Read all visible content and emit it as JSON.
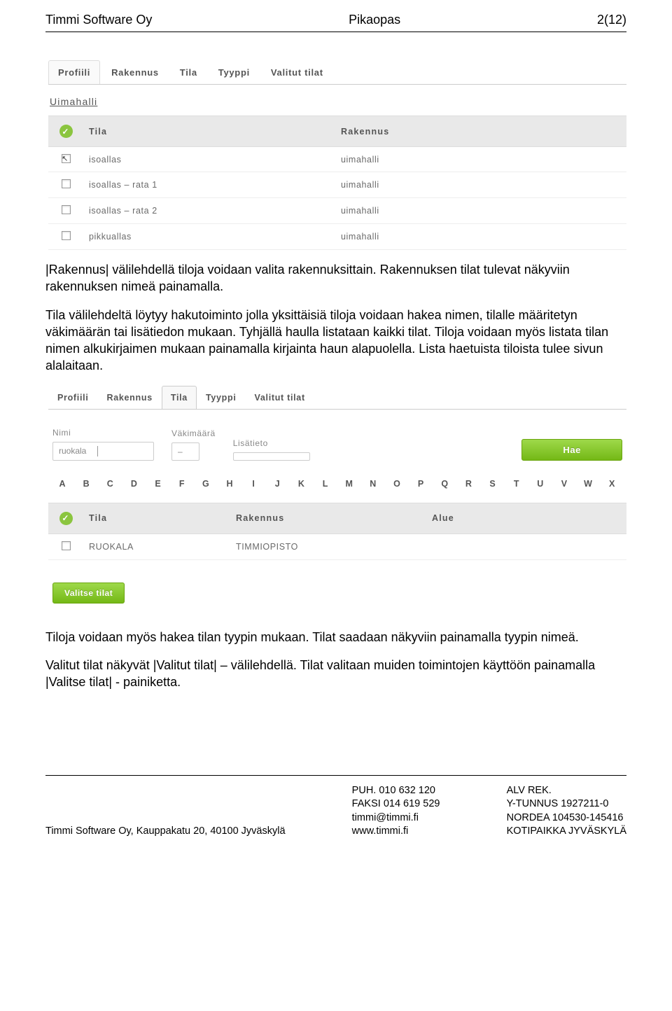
{
  "header": {
    "company": "Timmi Software Oy",
    "title": "Pikaopas",
    "page": "2(12)"
  },
  "paragraphs": {
    "p1": "|Rakennus| välilehdellä tiloja voidaan valita rakennuksittain. Rakennuksen tilat tulevat näkyviin rakennuksen nimeä painamalla.",
    "p2": "Tila välilehdeltä löytyy hakutoiminto jolla yksittäisiä tiloja voidaan hakea nimen, tilalle määritetyn väkimäärän tai lisätiedon mukaan. Tyhjällä haulla listataan kaikki tilat. Tiloja voidaan myös listata tilan nimen alkukirjaimen mukaan painamalla kirjainta haun alapuolella. Lista haetuista tiloista tulee sivun alalaitaan.",
    "p3": "Tiloja voidaan myös hakea tilan tyypin mukaan. Tilat saadaan näkyviin painamalla tyypin nimeä.",
    "p4": "Valitut tilat näkyvät |Valitut tilat| – välilehdellä. Tilat valitaan muiden toimintojen käyttöön painamalla |Valitse tilat| - painiketta."
  },
  "shot1": {
    "tabs": [
      "Profiili",
      "Rakennus",
      "Tila",
      "Tyyppi",
      "Valitut tilat"
    ],
    "section": "Uimahalli",
    "cols": {
      "tila": "Tila",
      "rakennus": "Rakennus"
    },
    "rows": [
      {
        "tila": "isoallas",
        "rakennus": "uimahalli"
      },
      {
        "tila": "isoallas – rata 1",
        "rakennus": "uimahalli"
      },
      {
        "tila": "isoallas – rata 2",
        "rakennus": "uimahalli"
      },
      {
        "tila": "pikkuallas",
        "rakennus": "uimahalli"
      }
    ]
  },
  "shot2": {
    "tabs": [
      "Profiili",
      "Rakennus",
      "Tila",
      "Tyyppi",
      "Valitut tilat"
    ],
    "activeTab": "Tila",
    "fields": {
      "nimi_label": "Nimi",
      "nimi_value": "ruokala",
      "vaki_label": "Väkimäärä",
      "vaki_value": "–",
      "lisa_label": "Lisätieto"
    },
    "search_btn": "Hae",
    "alphabet": [
      "A",
      "B",
      "C",
      "D",
      "E",
      "F",
      "G",
      "H",
      "I",
      "J",
      "K",
      "L",
      "M",
      "N",
      "O",
      "P",
      "Q",
      "R",
      "S",
      "T",
      "U",
      "V",
      "W",
      "X"
    ],
    "cols": {
      "tila": "Tila",
      "rakennus": "Rakennus",
      "alue": "Alue"
    },
    "rows": [
      {
        "tila": "RUOKALA",
        "rakennus": "TIMMIOPISTO",
        "alue": ""
      }
    ],
    "select_btn": "Valitse tilat"
  },
  "footer": {
    "address": "Timmi Software Oy, Kauppakatu 20, 40100 Jyväskylä",
    "phone_label": "PUH.",
    "phone": "010 632 120",
    "fax_label": "FAKSI",
    "fax": "014 619 529",
    "email": "timmi@timmi.fi",
    "web": "www.timmi.fi",
    "alv": "ALV REK.",
    "ytunnus_label": "Y-TUNNUS",
    "ytunnus": "1927211-0",
    "bank_label": "NORDEA",
    "bank": "104530-145416",
    "koti_label": "KOTIPAIKKA",
    "koti": "JYVÄSKYLÄ"
  }
}
